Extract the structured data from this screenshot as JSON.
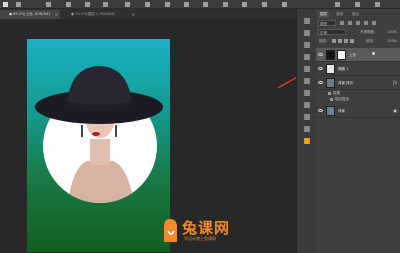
{
  "tabs": [
    {
      "label": "● 69.2%(上色, RGB/8#)"
    },
    {
      "label": "● 70.2%(图层 1, RGB/8#)"
    }
  ],
  "panel": {
    "tabs": [
      "图层",
      "通道",
      "路径"
    ],
    "kind_label": "类型",
    "blend_mode": "正常",
    "opacity_label": "不透明度:",
    "opacity_value": "100%",
    "lock_label": "锁定:",
    "fill_label": "填充:",
    "fill_value": "100%"
  },
  "layers": [
    {
      "name": "上色",
      "selected": true
    },
    {
      "name": "椭圆 1",
      "selected": false
    },
    {
      "name": "背景 拷贝",
      "selected": false
    },
    {
      "name": "背景",
      "selected": false
    }
  ],
  "effects": [
    "效果",
    "描边叠加"
  ],
  "watermark": {
    "brand": "兔课网",
    "tagline": "学设计就上兔课网"
  },
  "colors": {
    "gradient_top": "#1bb1c2",
    "gradient_bottom": "#135d1f",
    "arrow": "#e23a2e",
    "brand_orange": "#f08a2a"
  }
}
